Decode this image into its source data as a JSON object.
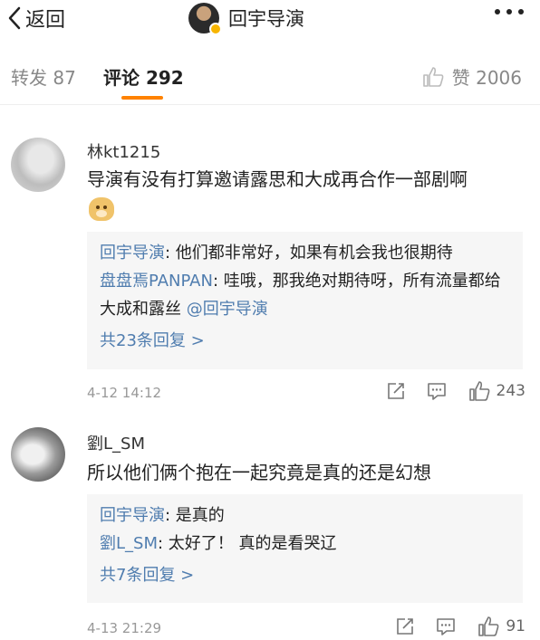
{
  "header": {
    "back_label": "返回",
    "account_name": "回宇导演"
  },
  "tabs": {
    "repost": "转发 87",
    "comment": "评论 292",
    "like": "赞 2006"
  },
  "comments": [
    {
      "username": "林kt1215",
      "text": "导演有没有打算邀请露思和大成再合作一部剧啊",
      "has_emoji": true,
      "replies": [
        {
          "name": "回宇导演",
          "text": ": 他们都非常好，如果有机会我也很期待"
        },
        {
          "name": "盘盘焉PANPAN",
          "text": ": 哇哦，那我绝对期待呀，所有流量都给大成和露丝 ",
          "mention": "@回宇导演"
        }
      ],
      "more_replies": "共23条回复 >",
      "time": "4-12 14:12",
      "likes": "243"
    },
    {
      "username": "劉L_SM",
      "text": "所以他们俩个抱在一起究竟是真的还是幻想",
      "has_emoji": false,
      "replies": [
        {
          "name": "回宇导演",
          "text": ": 是真的"
        },
        {
          "name": "劉L_SM",
          "text": ": 太好了！  真的是看哭辽"
        }
      ],
      "more_replies": "共7条回复 >",
      "time": "4-13 21:29",
      "likes": "91"
    }
  ],
  "colors": {
    "accent": "#ff8200",
    "link": "#507daf",
    "reply_bg": "#f6f6f6",
    "muted": "#999999"
  },
  "icons": [
    "chevron-left-icon",
    "more-icon",
    "like-icon",
    "share-icon",
    "reply-icon"
  ]
}
